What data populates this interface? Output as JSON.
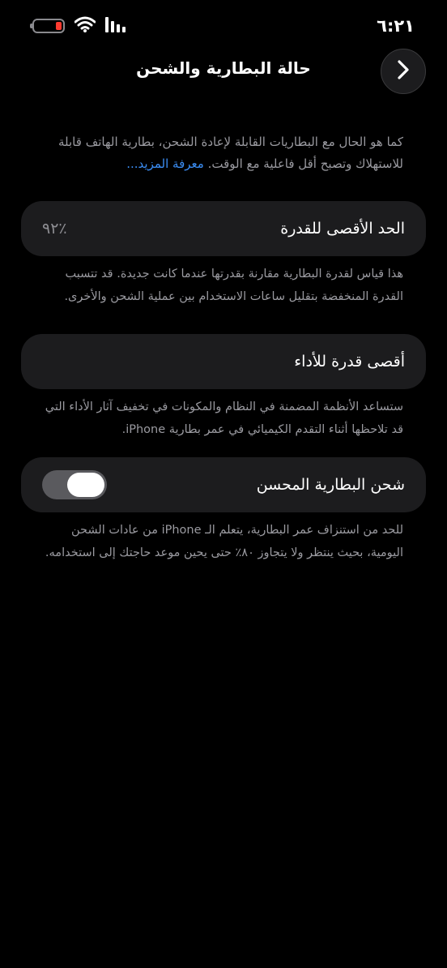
{
  "status_bar": {
    "time": "٦:٢١"
  },
  "header": {
    "title": "حالة البطارية والشحن"
  },
  "intro": {
    "text": "كما هو الحال مع البطاريات القابلة لإعادة الشحن، بطارية الهاتف قابلة للاستهلاك وتصبح أقل فاعلية مع الوقت.",
    "link_label": "معرفة المزيد..."
  },
  "maximum_capacity": {
    "label": "الحد الأقصى للقدرة",
    "value": "٪٩٢",
    "footnote": "هذا قياس لقدرة البطارية مقارنة بقدرتها عندما كانت جديدة. قد تتسبب القدرة المنخفضة بتقليل ساعات الاستخدام بين عملية الشحن والأخرى."
  },
  "peak_performance": {
    "label": "أقصى قدرة للأداء",
    "footnote": "ستساعد الأنظمة المضمنة في النظام والمكونات في تخفيف آثار الأداء التي قد تلاحظها أثناء التقدم الكيميائي في عمر بطارية iPhone."
  },
  "optimized_charging": {
    "label": "شحن البطارية المحسن",
    "enabled": true,
    "footnote": "للحد من استنزاف عمر البطارية، يتعلم الـ iPhone من عادات الشحن اليومية، بحيث ينتظر ولا يتجاوز ٨٠٪ حتى يحين موعد حاجتك إلى استخدامه."
  },
  "colors": {
    "background": "#000000",
    "card": "#1c1c1e",
    "secondary_text": "#9a9aa0",
    "link": "#3b8ef5",
    "battery_low": "#ff3b30",
    "toggle_track": "#5a5a5e"
  }
}
